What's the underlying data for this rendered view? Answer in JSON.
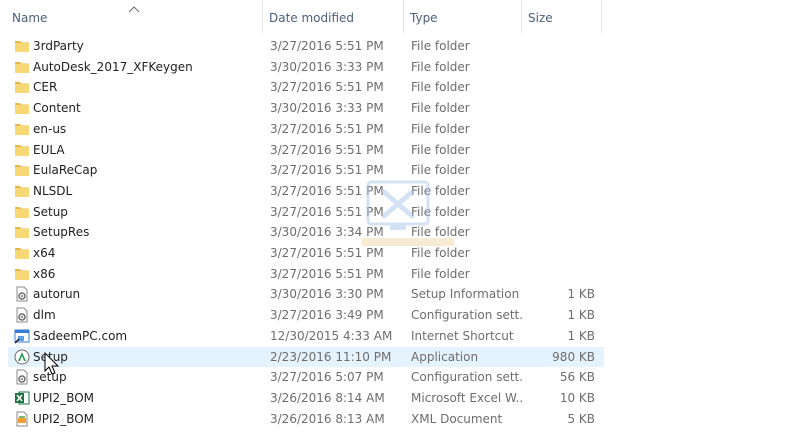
{
  "columns": {
    "name": "Name",
    "date": "Date modified",
    "type": "Type",
    "size": "Size"
  },
  "files": [
    {
      "name": "3rdParty",
      "date": "3/27/2016 5:51 PM",
      "type": "File folder",
      "size": "",
      "icon": "folder-icon"
    },
    {
      "name": "AutoDesk_2017_XFKeygen",
      "date": "3/30/2016 3:33 PM",
      "type": "File folder",
      "size": "",
      "icon": "folder-icon"
    },
    {
      "name": "CER",
      "date": "3/27/2016 5:51 PM",
      "type": "File folder",
      "size": "",
      "icon": "folder-icon"
    },
    {
      "name": "Content",
      "date": "3/30/2016 3:33 PM",
      "type": "File folder",
      "size": "",
      "icon": "folder-icon"
    },
    {
      "name": "en-us",
      "date": "3/27/2016 5:51 PM",
      "type": "File folder",
      "size": "",
      "icon": "folder-icon"
    },
    {
      "name": "EULA",
      "date": "3/27/2016 5:51 PM",
      "type": "File folder",
      "size": "",
      "icon": "folder-icon"
    },
    {
      "name": "EulaReCap",
      "date": "3/27/2016 5:51 PM",
      "type": "File folder",
      "size": "",
      "icon": "folder-icon"
    },
    {
      "name": "NLSDL",
      "date": "3/27/2016 5:51 PM",
      "type": "File folder",
      "size": "",
      "icon": "folder-icon"
    },
    {
      "name": "Setup",
      "date": "3/27/2016 5:51 PM",
      "type": "File folder",
      "size": "",
      "icon": "folder-icon"
    },
    {
      "name": "SetupRes",
      "date": "3/30/2016 3:34 PM",
      "type": "File folder",
      "size": "",
      "icon": "folder-icon"
    },
    {
      "name": "x64",
      "date": "3/27/2016 5:51 PM",
      "type": "File folder",
      "size": "",
      "icon": "folder-icon"
    },
    {
      "name": "x86",
      "date": "3/27/2016 5:51 PM",
      "type": "File folder",
      "size": "",
      "icon": "folder-icon"
    },
    {
      "name": "autorun",
      "date": "3/30/2016 3:30 PM",
      "type": "Setup Information",
      "size": "1 KB",
      "icon": "settings-file-icon"
    },
    {
      "name": "dlm",
      "date": "3/27/2016 3:49 PM",
      "type": "Configuration sett...",
      "size": "1 KB",
      "icon": "settings-file-icon"
    },
    {
      "name": "SadeemPC.com",
      "date": "12/30/2015 4:33 AM",
      "type": "Internet Shortcut",
      "size": "1 KB",
      "icon": "internet-shortcut-icon"
    },
    {
      "name": "Setup",
      "date": "2/23/2016 11:10 PM",
      "type": "Application",
      "size": "980 KB",
      "icon": "application-icon",
      "selected": true
    },
    {
      "name": "setup",
      "date": "3/27/2016 5:07 PM",
      "type": "Configuration sett...",
      "size": "56 KB",
      "icon": "settings-file-icon"
    },
    {
      "name": "UPI2_BOM",
      "date": "3/26/2016 8:14 AM",
      "type": "Microsoft Excel W...",
      "size": "10 KB",
      "icon": "excel-file-icon"
    },
    {
      "name": "UPI2_BOM",
      "date": "3/26/2016 8:13 AM",
      "type": "XML Document",
      "size": "5 KB",
      "icon": "xml-file-icon"
    }
  ],
  "colors": {
    "folder": "#f8d775",
    "selection": "#e5f3ff",
    "header_text": "#4c607a",
    "secondary_text": "#6d6d6d"
  }
}
